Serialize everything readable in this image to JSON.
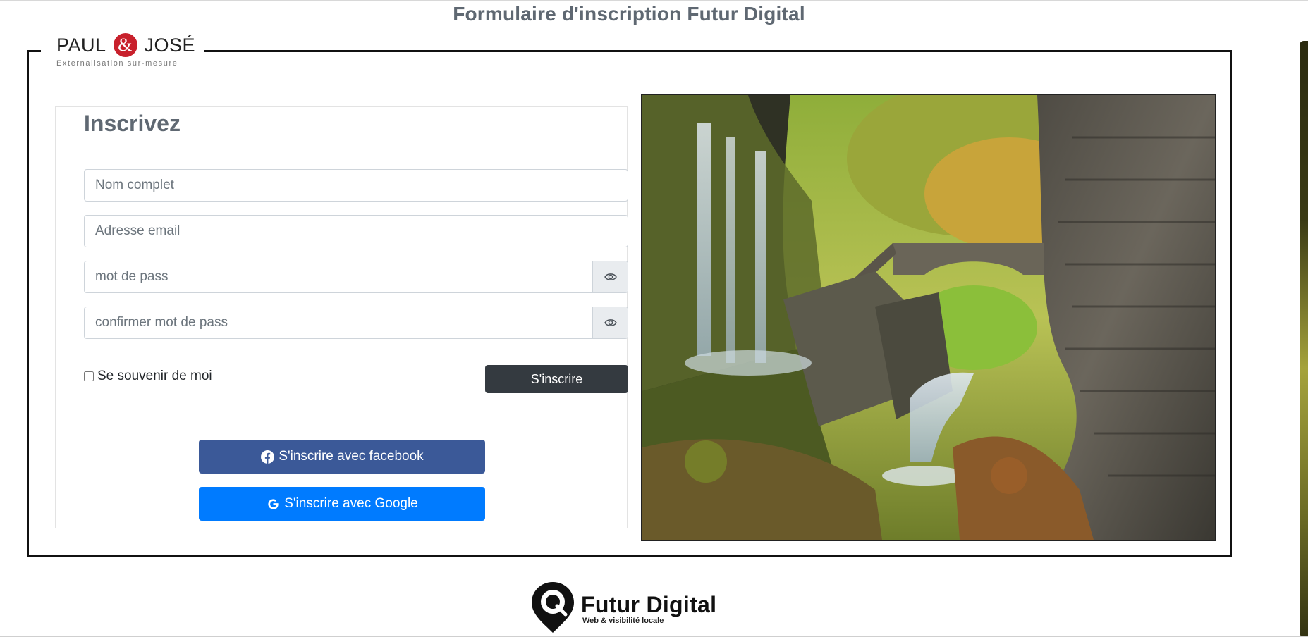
{
  "page": {
    "title": "Formulaire d'inscription Futur Digital"
  },
  "brand": {
    "left_word": "PAUL",
    "ampersand": "&",
    "right_word": "JOSÉ",
    "tagline": "Externalisation sur-mesure",
    "accent_color": "#c8202c"
  },
  "form": {
    "heading": "Inscrivez",
    "fields": {
      "full_name": {
        "placeholder": "Nom complet",
        "value": ""
      },
      "email": {
        "placeholder": "Adresse email",
        "value": ""
      },
      "password": {
        "placeholder": "mot de pass",
        "value": "",
        "toggle_icon": "eye-icon"
      },
      "confirm_password": {
        "placeholder": "confirmer mot de pass",
        "value": "",
        "toggle_icon": "eye-icon"
      }
    },
    "remember_label": "Se souvenir de moi",
    "remember_checked": false,
    "submit_label": "S'inscrire",
    "submit_color": "#343a40"
  },
  "social": {
    "facebook": {
      "label": "S'inscrire avec facebook",
      "icon": "facebook-icon",
      "color": "#3b5998"
    },
    "google": {
      "label": "S'inscrire avec Google",
      "icon": "google-icon",
      "color": "#007bff"
    }
  },
  "hero_image": {
    "subject": "gorge-waterfall-stone-bridge-photo"
  },
  "footer": {
    "logo_name": "Futur Digital",
    "logo_tagline": "Web & visibilité locale",
    "logo_icon": "location-pin-icon"
  }
}
